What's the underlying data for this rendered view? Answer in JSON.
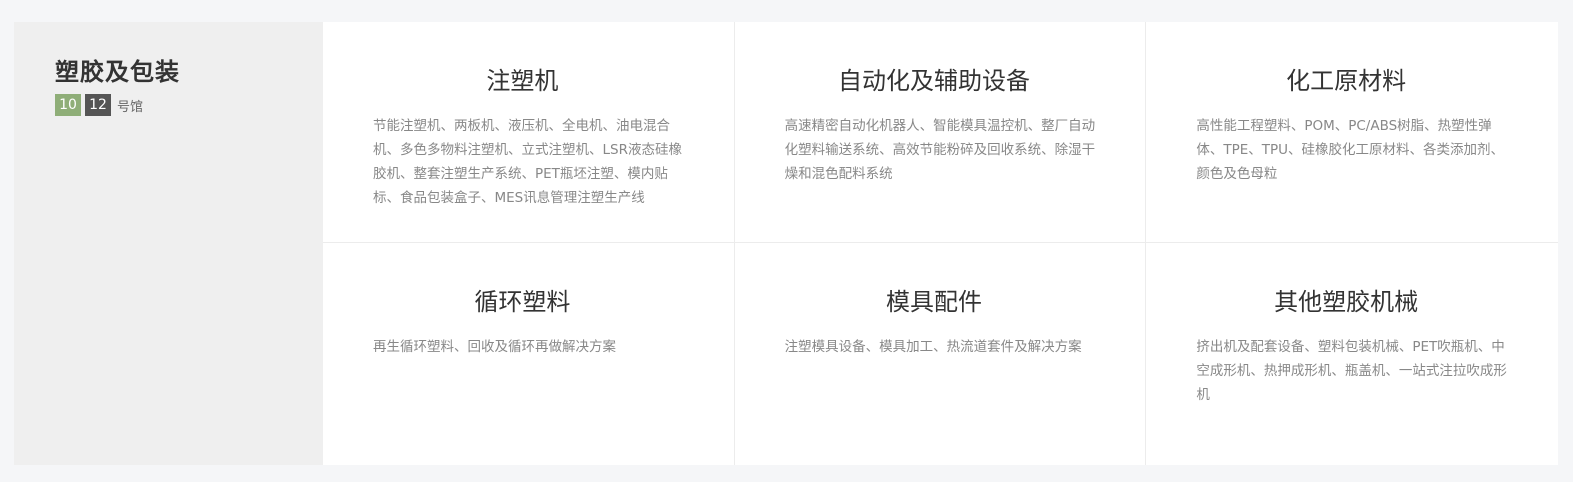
{
  "sidebar": {
    "title": "塑胶及包装",
    "halls": [
      {
        "number": "10",
        "color": "#8fae78"
      },
      {
        "number": "12",
        "color": "#555555"
      }
    ],
    "hall_suffix": "号馆"
  },
  "categories": [
    {
      "title": "注塑机",
      "description": "节能注塑机、两板机、液压机、全电机、油电混合机、多色多物料注塑机、立式注塑机、LSR液态硅橡胶机、整套注塑生产系统、PET瓶坯注塑、模内贴标、食品包装盒子、MES讯息管理注塑生产线"
    },
    {
      "title": "自动化及辅助设备",
      "description": "高速精密自动化机器人、智能模具温控机、整厂自动化塑料输送系统、高效节能粉碎及回收系统、除湿干燥和混色配料系统"
    },
    {
      "title": "化工原材料",
      "description": "高性能工程塑料、POM、PC/ABS树脂、热塑性弹体、TPE、TPU、硅橡胶化工原材料、各类添加剂、颜色及色母粒"
    },
    {
      "title": "循环塑料",
      "description": "再生循环塑料、回收及循环再做解决方案"
    },
    {
      "title": "模具配件",
      "description": "注塑模具设备、模具加工、热流道套件及解决方案"
    },
    {
      "title": "其他塑胶机械",
      "description": "挤出机及配套设备、塑料包装机械、PET吹瓶机、中空成形机、热押成形机、瓶盖机、一站式注拉吹成形机"
    }
  ]
}
